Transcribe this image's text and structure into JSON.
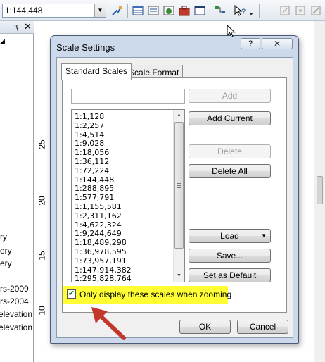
{
  "toolbar": {
    "scale_value": "1:144,448",
    "icons": [
      "select-elements-icon",
      "table-icon",
      "identify-icon",
      "catalog-icon",
      "toolbox-icon",
      "python-window-icon",
      "model-builder-icon",
      "whats-this-icon",
      "overflow-icon",
      "edit-tool-icon",
      "edit-vertices-icon",
      "editor-icon"
    ]
  },
  "left_panel": {
    "header_pin": "ԇ",
    "header_close": "✕",
    "items": [
      "ry",
      "ery",
      "ery",
      "rs-2009",
      "rs-2004",
      "elevation",
      "elevation"
    ]
  },
  "ruler": {
    "labels": [
      "25",
      "20",
      "15",
      "10"
    ]
  },
  "dialog": {
    "title": "Scale Settings",
    "help": "?",
    "close": "✕",
    "tabs": [
      {
        "label": "Standard Scales",
        "active": true
      },
      {
        "label": "Scale Format",
        "active": false
      }
    ],
    "scale_input": {
      "value": "",
      "placeholder": ""
    },
    "scales": [
      "1:1,128",
      "1:2,257",
      "1:4,514",
      "1:9,028",
      "1:18,056",
      "1:36,112",
      "1:72,224",
      "1:144,448",
      "1:288,895",
      "1:577,791",
      "1:1,155,581",
      "1:2,311,162",
      "1:4,622,324",
      "1:9,244,649",
      "1:18,489,298",
      "1:36,978,595",
      "1:73,957,191",
      "1:147,914,382",
      "1:295,828,764"
    ],
    "buttons": {
      "add": "Add",
      "add_current": "Add Current",
      "delete": "Delete",
      "delete_all": "Delete All",
      "load": "Load",
      "save": "Save...",
      "set_default": "Set as Default",
      "ok": "OK",
      "cancel": "Cancel"
    },
    "checkbox": {
      "label": "Only display these scales when zooming",
      "checked": true
    }
  },
  "colors": {
    "highlight": "#ffff33",
    "annotation_arrow": "#c0392b",
    "dialog_frame": "#ccd9ea"
  }
}
